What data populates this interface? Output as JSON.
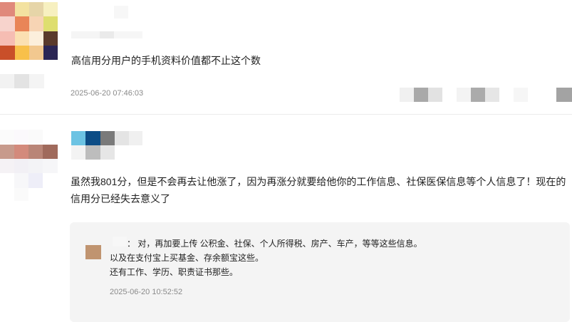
{
  "comments": [
    {
      "text": "高信用分用户的手机资料价值都不止这个数",
      "time": "2025-06-20 07:46:03"
    },
    {
      "text_line1": "虽然我801分，但是不会再去让他涨了，因为再涨分就要给他你的工作信息、社保医保信息等个人信息了！现在的",
      "text_line2": "信用分已经失去意义了",
      "reply": {
        "line1": "：  对，再加要上传 公积金、社保、个人所得税、房产、车产，等等这些信息。",
        "line2": "以及在支付宝上买基金、存余额宝这些。",
        "line3": "还有工作、学历、职责证书那些。",
        "time": "2025-06-20 10:52:52"
      }
    }
  ],
  "colors": {
    "text": "#222222",
    "time": "#8a8a8a",
    "divider": "#ececec",
    "reply_bg": "#f4f4f4"
  }
}
